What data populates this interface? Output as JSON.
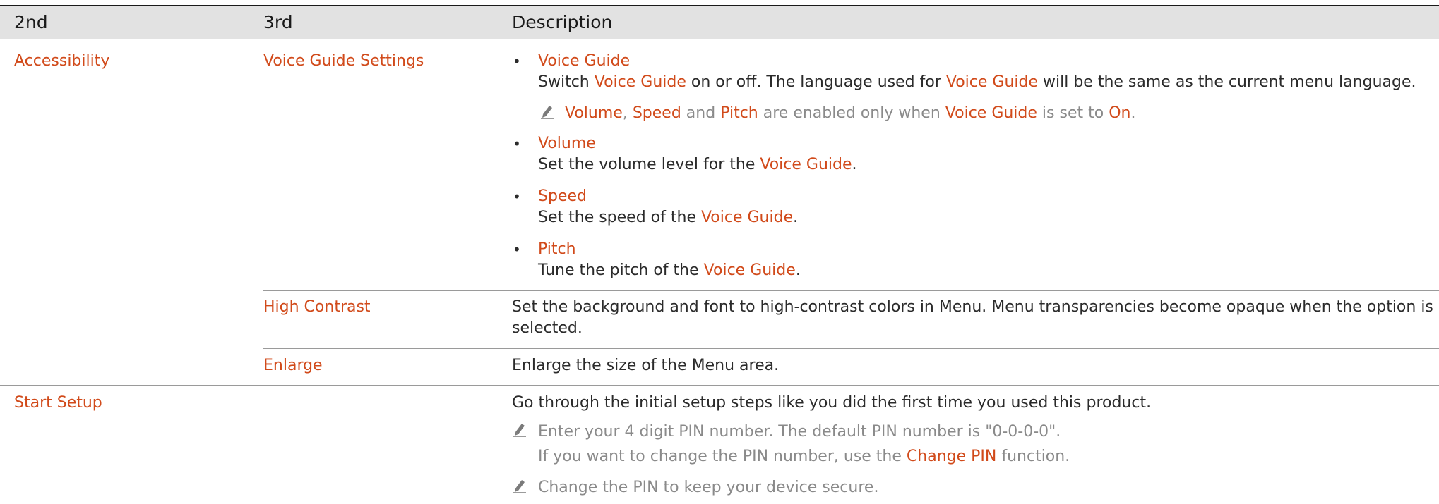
{
  "columns": [
    "2nd",
    "3rd",
    "Description"
  ],
  "sections": {
    "accessibility": {
      "label": "Accessibility",
      "voice_guide_settings": {
        "label": "Voice Guide Settings",
        "items": [
          {
            "title": "Voice Guide",
            "desc_pre": "Switch ",
            "desc_term": "Voice Guide",
            "desc_mid": " on or off. The language used for ",
            "desc_term2": "Voice Guide",
            "desc_post": " will be the same as the current menu language."
          },
          {
            "title": "Volume",
            "desc_pre": "Set the volume level for the ",
            "desc_term": "Voice Guide",
            "desc_post": "."
          },
          {
            "title": "Speed",
            "desc_pre": "Set the speed of the ",
            "desc_term": "Voice Guide",
            "desc_post": "."
          },
          {
            "title": "Pitch",
            "desc_pre": "Tune the pitch of the ",
            "desc_term": "Voice Guide",
            "desc_post": "."
          }
        ],
        "note": {
          "t1": "Volume",
          "s1": ", ",
          "t2": "Speed",
          "s2": " and ",
          "t3": "Pitch",
          "s3": " are enabled only when ",
          "t4": "Voice Guide",
          "s4": " is set to ",
          "t5": "On",
          "s5": "."
        }
      },
      "high_contrast": {
        "label": "High Contrast",
        "line1": "Set the background and font to high-contrast colors in Menu. Menu transparencies become opaque when the option is",
        "line2": "selected."
      },
      "enlarge": {
        "label": "Enlarge",
        "desc": "Enlarge the size of the Menu area."
      }
    },
    "start_setup": {
      "label": "Start Setup",
      "desc": "Go through the initial setup steps like you did the first time you used this product.",
      "note1_line1": "Enter your 4 digit PIN number. The default PIN number is \"0-0-0-0\".",
      "note1_line2_pre": "If you want to change the PIN number, use the ",
      "note1_line2_term": "Change PIN",
      "note1_line2_post": " function.",
      "note2": "Change the PIN to keep your device secure."
    }
  },
  "colors": {
    "accent": "#d14a1a",
    "header_bg": "#e2e2e2",
    "note_text": "#8a8a8a",
    "rule": "#9a9a9a"
  },
  "icons": {
    "bullet": "•",
    "note": "pencil-icon"
  }
}
